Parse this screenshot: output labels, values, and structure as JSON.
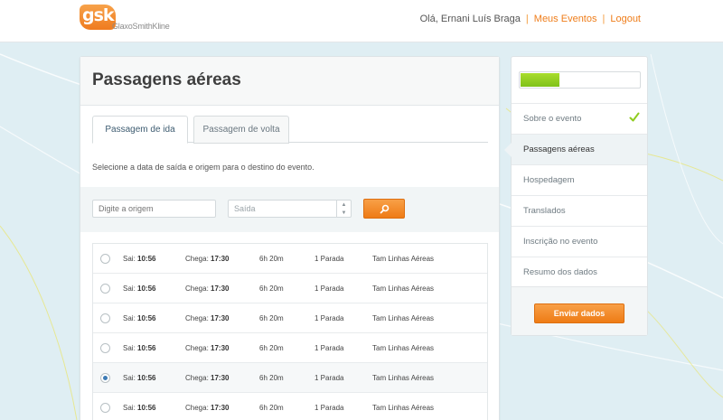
{
  "brand": {
    "logo_mark": "gsk",
    "logo_text": "GlaxoSmithKline",
    "accent": "#ef7d1a"
  },
  "header": {
    "greeting": "Olá, Ernani Luís Braga",
    "nav": [
      {
        "label": "Meus Eventos"
      },
      {
        "label": "Logout"
      }
    ]
  },
  "main": {
    "title": "Passagens aéreas",
    "tabs": [
      {
        "label": "Passagem de ida",
        "active": true
      },
      {
        "label": "Passagem de volta",
        "active": false
      }
    ],
    "intro": "Selecione a data de saída e origem para o destino do evento.",
    "search": {
      "origin_placeholder": "Digite a origem",
      "date_value": "Saída",
      "search_icon": "search-icon"
    },
    "flights": [
      {
        "sai_label": "Sai:",
        "sai": "10:56",
        "chega_label": "Chega:",
        "chega": "17:30",
        "duration": "6h 20m",
        "stops": "1 Parada",
        "airline": "Tam Linhas Aéreas",
        "selected": false
      },
      {
        "sai_label": "Sai:",
        "sai": "10:56",
        "chega_label": "Chega:",
        "chega": "17:30",
        "duration": "6h 20m",
        "stops": "1 Parada",
        "airline": "Tam Linhas Aéreas",
        "selected": false
      },
      {
        "sai_label": "Sai:",
        "sai": "10:56",
        "chega_label": "Chega:",
        "chega": "17:30",
        "duration": "6h 20m",
        "stops": "1 Parada",
        "airline": "Tam Linhas Aéreas",
        "selected": false
      },
      {
        "sai_label": "Sai:",
        "sai": "10:56",
        "chega_label": "Chega:",
        "chega": "17:30",
        "duration": "6h 20m",
        "stops": "1 Parada",
        "airline": "Tam Linhas Aéreas",
        "selected": false
      },
      {
        "sai_label": "Sai:",
        "sai": "10:56",
        "chega_label": "Chega:",
        "chega": "17:30",
        "duration": "6h 20m",
        "stops": "1 Parada",
        "airline": "Tam Linhas Aéreas",
        "selected": true
      },
      {
        "sai_label": "Sai:",
        "sai": "10:56",
        "chega_label": "Chega:",
        "chega": "17:30",
        "duration": "6h 20m",
        "stops": "1 Parada",
        "airline": "Tam Linhas Aéreas",
        "selected": false
      }
    ]
  },
  "sidebar": {
    "progress": 0.33,
    "progress_color": "#8fcc1f",
    "steps": [
      {
        "label": "Sobre o evento",
        "done": true,
        "active": false
      },
      {
        "label": "Passagens aéreas",
        "done": false,
        "active": true
      },
      {
        "label": "Hospedagem",
        "done": false,
        "active": false
      },
      {
        "label": "Translados",
        "done": false,
        "active": false
      },
      {
        "label": "Inscrição no evento",
        "done": false,
        "active": false
      },
      {
        "label": "Resumo dos dados",
        "done": false,
        "active": false
      }
    ],
    "check_icon": "check-icon",
    "submit_label": "Enviar dados"
  }
}
